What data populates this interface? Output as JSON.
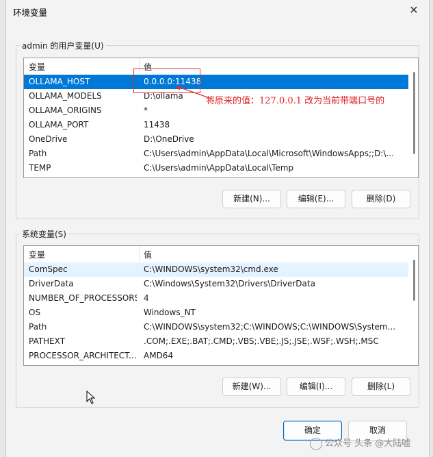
{
  "window": {
    "title": "环境变量",
    "close_icon": "close-icon",
    "ok_label": "确定",
    "cancel_label": "取消"
  },
  "user_vars": {
    "group_label": "admin 的用户变量(U)",
    "col_var": "变量",
    "col_value": "值",
    "rows": [
      {
        "name": "OLLAMA_HOST",
        "value": "0.0.0.0:11438"
      },
      {
        "name": "OLLAMA_MODELS",
        "value": "D:\\ollama"
      },
      {
        "name": "OLLAMA_ORIGINS",
        "value": "*"
      },
      {
        "name": "OLLAMA_PORT",
        "value": "11438"
      },
      {
        "name": "OneDrive",
        "value": "D:\\OneDrive"
      },
      {
        "name": "Path",
        "value": "C:\\Users\\admin\\AppData\\Local\\Microsoft\\WindowsApps;;D:\\..."
      },
      {
        "name": "TEMP",
        "value": "C:\\Users\\admin\\AppData\\Local\\Temp"
      }
    ],
    "selected_index": 0,
    "new_label": "新建(N)...",
    "edit_label": "编辑(E)...",
    "delete_label": "删除(D)"
  },
  "system_vars": {
    "group_label": "系统变量(S)",
    "col_var": "变量",
    "col_value": "值",
    "rows": [
      {
        "name": "ComSpec",
        "value": "C:\\WINDOWS\\system32\\cmd.exe"
      },
      {
        "name": "DriverData",
        "value": "C:\\Windows\\System32\\Drivers\\DriverData"
      },
      {
        "name": "NUMBER_OF_PROCESSORS",
        "value": "4"
      },
      {
        "name": "OS",
        "value": "Windows_NT"
      },
      {
        "name": "Path",
        "value": "C:\\WINDOWS\\system32;C:\\WINDOWS;C:\\WINDOWS\\System..."
      },
      {
        "name": "PATHEXT",
        "value": ".COM;.EXE;.BAT;.CMD;.VBS;.VBE;.JS;.JSE;.WSF;.WSH;.MSC"
      },
      {
        "name": "PROCESSOR_ARCHITECT...",
        "value": "AMD64"
      }
    ],
    "hover_index": 0,
    "new_label": "新建(W)...",
    "edit_label": "编辑(I)...",
    "delete_label": "删除(L)"
  },
  "annotation": {
    "text": "将原来的值：127.0.0.1 改为当前带端口号的",
    "color": "#e02020"
  },
  "watermark": {
    "text": "公众号 头条 @大陆嘘"
  },
  "colors": {
    "selection": "#0078d7",
    "hover": "#e5f3ff",
    "primary_border": "#0067c0"
  }
}
